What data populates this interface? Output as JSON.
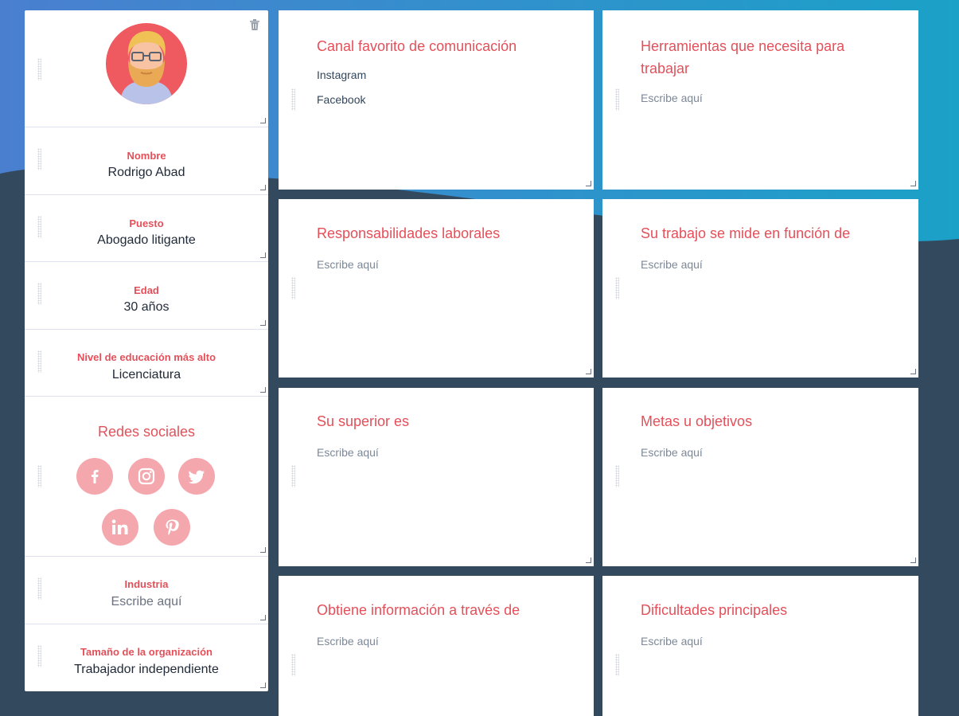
{
  "profile": {
    "avatar": "bearded-man-with-glasses-avatar",
    "fields": [
      {
        "label": "Nombre",
        "value": "Rodrigo Abad"
      },
      {
        "label": "Puesto",
        "value": "Abogado litigante"
      },
      {
        "label": "Edad",
        "value": "30 años"
      },
      {
        "label": "Nivel de educación más alto",
        "value": "Licenciatura"
      }
    ],
    "social": {
      "title": "Redes sociales",
      "icons": [
        "facebook-icon",
        "instagram-icon",
        "twitter-icon",
        "linkedin-icon",
        "pinterest-icon"
      ]
    },
    "fields2": [
      {
        "label": "Industria",
        "value": "Escribe aquí"
      },
      {
        "label": "Tamaño de la organización",
        "value": "Trabajador independiente"
      }
    ]
  },
  "cards": [
    {
      "title": "Canal favorito de comunicación",
      "lines": [
        "Instagram",
        "Facebook"
      ]
    },
    {
      "title": "Herramientas que necesita para trabajar",
      "placeholder": "Escribe aquí"
    },
    {
      "title": "Responsabilidades laborales",
      "placeholder": "Escribe aquí"
    },
    {
      "title": "Su trabajo se mide en función de",
      "placeholder": "Escribe aquí"
    },
    {
      "title": "Su superior es",
      "placeholder": "Escribe aquí"
    },
    {
      "title": "Metas u objetivos",
      "placeholder": "Escribe aquí"
    },
    {
      "title": "Obtiene información a través de",
      "placeholder": "Escribe aquí"
    },
    {
      "title": "Dificultades principales",
      "placeholder": "Escribe aquí"
    }
  ],
  "colors": {
    "accent": "#e4505a",
    "social_bg": "#f4a7ad",
    "dark_bg": "#33495e",
    "blue_bg_left": "#4a7fd0",
    "blue_bg_right": "#1ba1c8"
  }
}
